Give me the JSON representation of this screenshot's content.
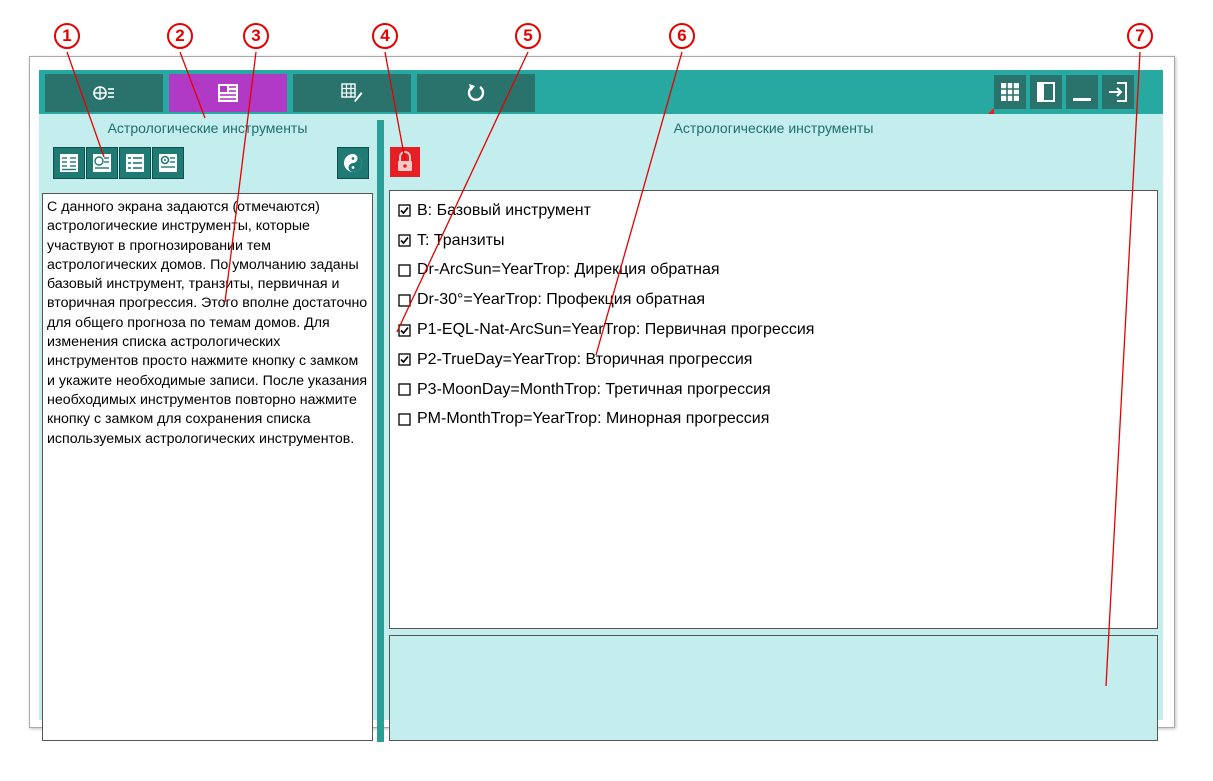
{
  "colors": {
    "toolbar_bg": "#27a8a0",
    "tab_dark": "#2a736d",
    "tab_active": "#b03ac6",
    "panel_bg": "#c4eeed",
    "lock_red": "#e51f23",
    "callout_red": "#e60000"
  },
  "callouts": [
    "1",
    "2",
    "3",
    "4",
    "5",
    "6",
    "7"
  ],
  "toolbar": {
    "tabs": [
      {
        "icon": "circle-list-icon",
        "active": false
      },
      {
        "icon": "panel-list-icon",
        "active": true
      },
      {
        "icon": "grid-pen-icon",
        "active": false
      },
      {
        "icon": "refresh-icon",
        "active": false
      }
    ],
    "right_buttons": [
      "grid-icon",
      "panel-toggle-icon",
      "minimize-icon",
      "exit-icon"
    ]
  },
  "left_panel": {
    "title": "Астрологические инструменты",
    "buttons": [
      "table-icon",
      "chart-clock-icon",
      "list-icon",
      "gear-list-icon"
    ],
    "extra_button": "yin-yang-icon",
    "description": "С данного экрана задаются (отмечаются) астрологические инструменты, которые участвуют в прогнозировании тем астрологических домов. По умолчанию заданы базовый инструмент, транзиты, первичная и вторичная прогрессия. Этого вполне достаточно для общего прогноза по темам домов. Для изменения списка астрологических инструментов просто нажмите кнопку с замком и укажите необходимые записи. После указания необходимых инструментов повторно нажмите кнопку с замком для сохранения списка используемых астрологических инструментов."
  },
  "right_panel": {
    "title": "Астрологические инструменты",
    "lock_button": "lock-icon",
    "items": [
      {
        "label": "B: Базовый инструмент",
        "checked": true
      },
      {
        "label": "T: Транзиты",
        "checked": true
      },
      {
        "label": "Dr-ArcSun=YearTrop: Дирекция обратная",
        "checked": false
      },
      {
        "label": "Dr-30°=YearTrop: Профекция обратная",
        "checked": false
      },
      {
        "label": "P1-EQL-Nat-ArcSun=YearTrop: Первичная прогрессия",
        "checked": true
      },
      {
        "label": "P2-TrueDay=YearTrop: Вторичная прогрессия",
        "checked": true
      },
      {
        "label": "P3-MoonDay=MonthTrop: Третичная прогрессия",
        "checked": false
      },
      {
        "label": "PM-MonthTrop=YearTrop: Минорная прогрессия",
        "checked": false
      }
    ]
  }
}
